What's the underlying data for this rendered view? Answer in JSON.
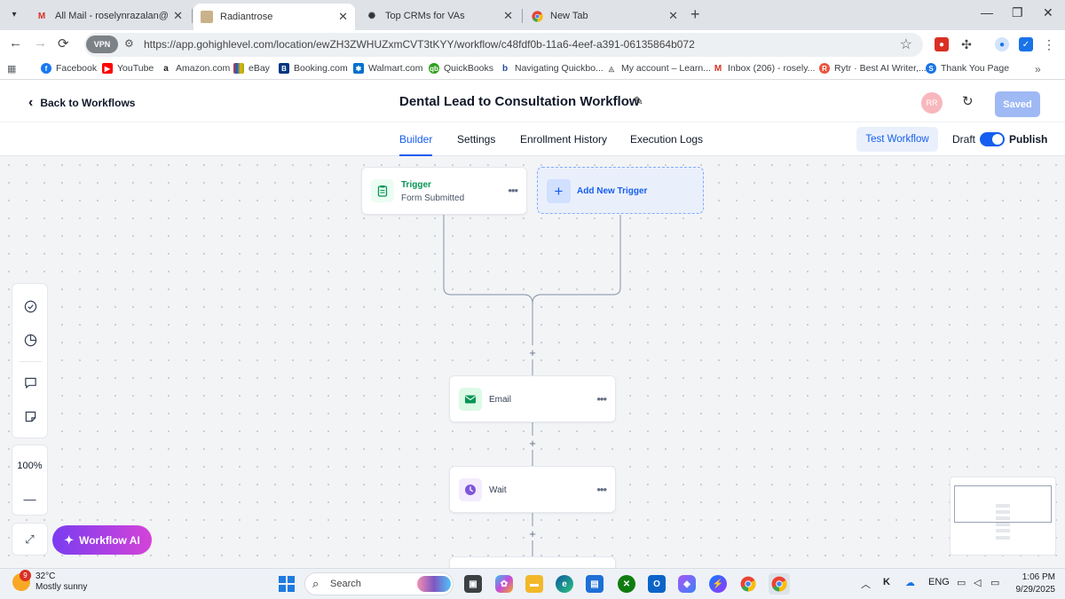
{
  "browser": {
    "tabs": [
      {
        "title": "All Mail - roselynrazalan@gmai"
      },
      {
        "title": "Radiantrose"
      },
      {
        "title": "Top CRMs for VAs"
      },
      {
        "title": "New Tab"
      }
    ],
    "vpn_label": "VPN",
    "url": "https://app.gohighlevel.com/location/ewZH3ZWHUZxmCVT3tKYY/workflow/c48fdf0b-11a6-4eef-a391-06135864b072",
    "bookmarks": [
      {
        "label": "Facebook"
      },
      {
        "label": "YouTube"
      },
      {
        "label": "Amazon.com"
      },
      {
        "label": "eBay"
      },
      {
        "label": "Booking.com"
      },
      {
        "label": "Walmart.com"
      },
      {
        "label": "QuickBooks"
      },
      {
        "label": "Navigating Quickbo..."
      },
      {
        "label": "My account – Learn..."
      },
      {
        "label": "Inbox (206) - rosely..."
      },
      {
        "label": "Rytr · Best AI Writer,..."
      },
      {
        "label": "Thank You Page"
      }
    ]
  },
  "header": {
    "back_label": "Back to Workflows",
    "title": "Dental Lead to Consultation Workflow",
    "avatar_initials": "RR",
    "saved_label": "Saved"
  },
  "subnav": {
    "tabs": [
      {
        "label": "Builder"
      },
      {
        "label": "Settings"
      },
      {
        "label": "Enrollment History"
      },
      {
        "label": "Execution Logs"
      }
    ],
    "test_label": "Test Workflow",
    "draft_label": "Draft",
    "publish_label": "Publish",
    "published": true
  },
  "canvas": {
    "trigger": {
      "title": "Trigger",
      "subtitle": "Form Submitted"
    },
    "add_trigger_label": "Add New Trigger",
    "actions": [
      {
        "label": "Email",
        "icon": "email-icon"
      },
      {
        "label": "Wait",
        "icon": "clock-icon"
      }
    ],
    "zoom": "100%",
    "ai_label": "Workflow AI"
  },
  "taskbar": {
    "temperature": "32°C",
    "weather": "Mostly sunny",
    "weather_badge": "9",
    "search_label": "Search",
    "language": "ENG",
    "time": "1:06 PM",
    "date": "9/29/2025"
  },
  "colors": {
    "accent": "#155eef",
    "email_icon_bg": "#dcfae6",
    "email_icon": "#079455",
    "wait_icon_bg": "#f4ebff",
    "wait_icon": "#7f56d9"
  }
}
